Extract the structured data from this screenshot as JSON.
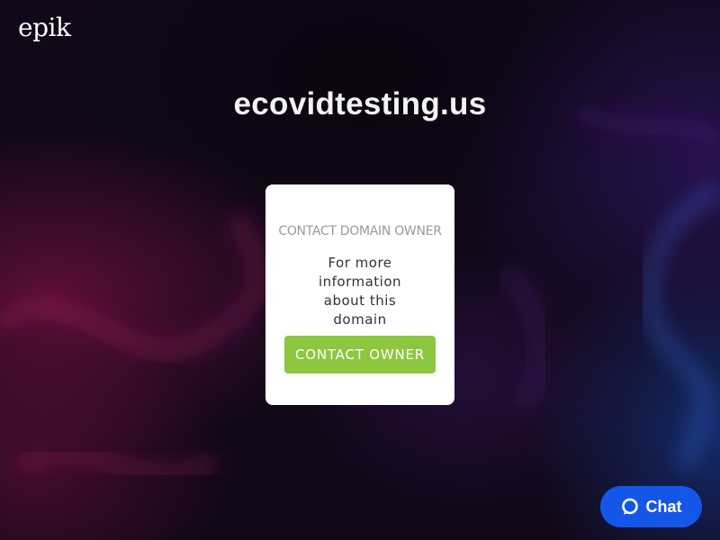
{
  "brand": {
    "logo_text": "epik"
  },
  "header": {
    "domain": "ecovidtesting.us"
  },
  "card": {
    "heading": "CONTACT DOMAIN OWNER",
    "description": "For more information about this domain",
    "button_label": "CONTACT OWNER"
  },
  "chat": {
    "label": "Chat",
    "icon": "chat-bubble-icon"
  },
  "colors": {
    "button_green": "#8dc63f",
    "chat_blue": "#1457e8",
    "background": "#12081a"
  }
}
